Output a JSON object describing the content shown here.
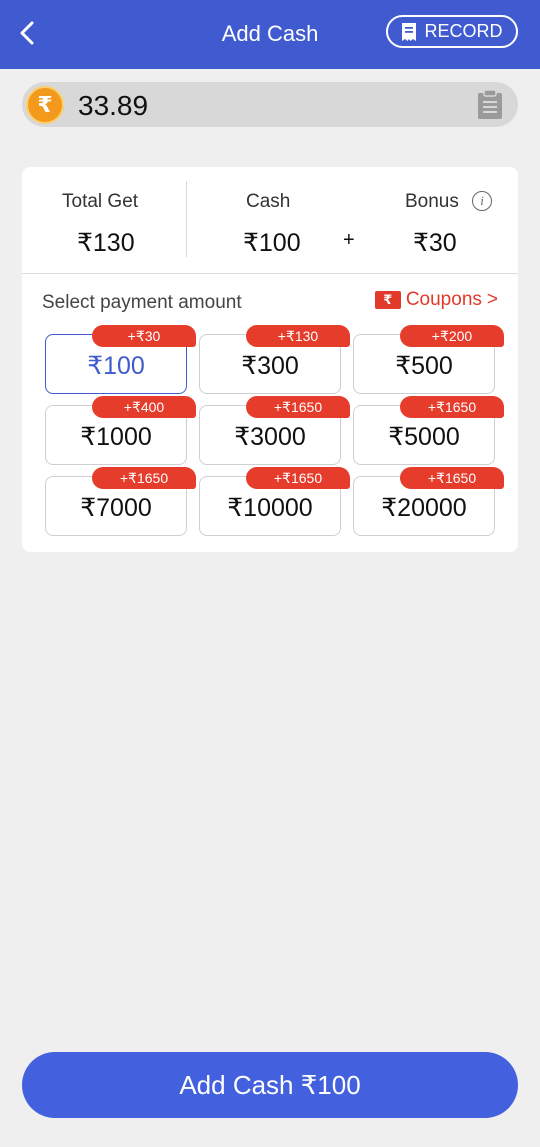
{
  "header": {
    "title": "Add Cash",
    "record_label": "RECORD",
    "bg_color": "#3f5bcf"
  },
  "balance": {
    "currency_symbol": "₹",
    "value": "33.89"
  },
  "summary": {
    "total_label": "Total Get",
    "total_value": "₹130",
    "cash_label": "Cash",
    "cash_value": "₹100",
    "plus": "+",
    "bonus_label": "Bonus",
    "bonus_value": "₹30",
    "info_glyph": "i"
  },
  "payment": {
    "select_label": "Select payment amount",
    "coupons_label": "Coupons",
    "coupons_chevron": ">",
    "coupon_glyph": "₹",
    "accent_color": "#e23a2a",
    "amounts": [
      {
        "amount": "₹100",
        "bonus": "+₹30",
        "selected": true
      },
      {
        "amount": "₹300",
        "bonus": "+₹130",
        "selected": false
      },
      {
        "amount": "₹500",
        "bonus": "+₹200",
        "selected": false
      },
      {
        "amount": "₹1000",
        "bonus": "+₹400",
        "selected": false
      },
      {
        "amount": "₹3000",
        "bonus": "+₹1650",
        "selected": false
      },
      {
        "amount": "₹5000",
        "bonus": "+₹1650",
        "selected": false
      },
      {
        "amount": "₹7000",
        "bonus": "+₹1650",
        "selected": false
      },
      {
        "amount": "₹10000",
        "bonus": "+₹1650",
        "selected": false
      },
      {
        "amount": "₹20000",
        "bonus": "+₹1650",
        "selected": false
      }
    ]
  },
  "footer": {
    "add_cash_label": "Add Cash ₹100"
  },
  "icons": {
    "back": "chevron-left-icon",
    "record": "receipt-icon",
    "coin": "rupee-coin-icon",
    "clipboard": "clipboard-icon",
    "info": "info-icon",
    "coupon": "coupon-ticket-icon"
  }
}
